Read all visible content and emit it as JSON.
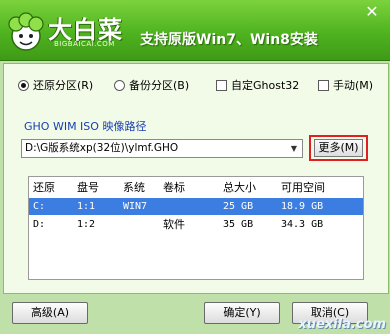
{
  "titlebar": {
    "logo_text": "大白菜",
    "logo_sub": "BIGBAICAI.COM",
    "slogan": "支持原版Win7、Win8安装",
    "close_icon": "close-icon"
  },
  "options": {
    "restore": "还原分区(R)",
    "backup": "备份分区(B)",
    "custom_ghost": "自定Ghost32",
    "manual": "手动(M)",
    "selected": "restore"
  },
  "path": {
    "label": "GHO WIM ISO 映像路径",
    "value": "D:\\G版系统xp(32位)\\ylmf.GHO"
  },
  "more_button": "更多(M)",
  "table": {
    "columns": [
      "还原",
      "盘号",
      "系统",
      "卷标",
      "总大小",
      "可用空间"
    ],
    "rows": [
      {
        "restore": "C:",
        "disk": "1:1",
        "system": "WIN7",
        "label": "",
        "total": "25 GB",
        "free": "18.9 GB",
        "selected": true
      },
      {
        "restore": "D:",
        "disk": "1:2",
        "system": "",
        "label": "软件",
        "total": "35 GB",
        "free": "34.3 GB",
        "selected": false
      }
    ]
  },
  "buttons": {
    "advanced": "高级(A)",
    "ok": "确定(Y)",
    "cancel": "取消(C)"
  },
  "watermark": "xuexila.com",
  "colors": {
    "titlebar": "#4fb320",
    "selection": "#3b7de0",
    "highlight_box": "#e02020"
  }
}
